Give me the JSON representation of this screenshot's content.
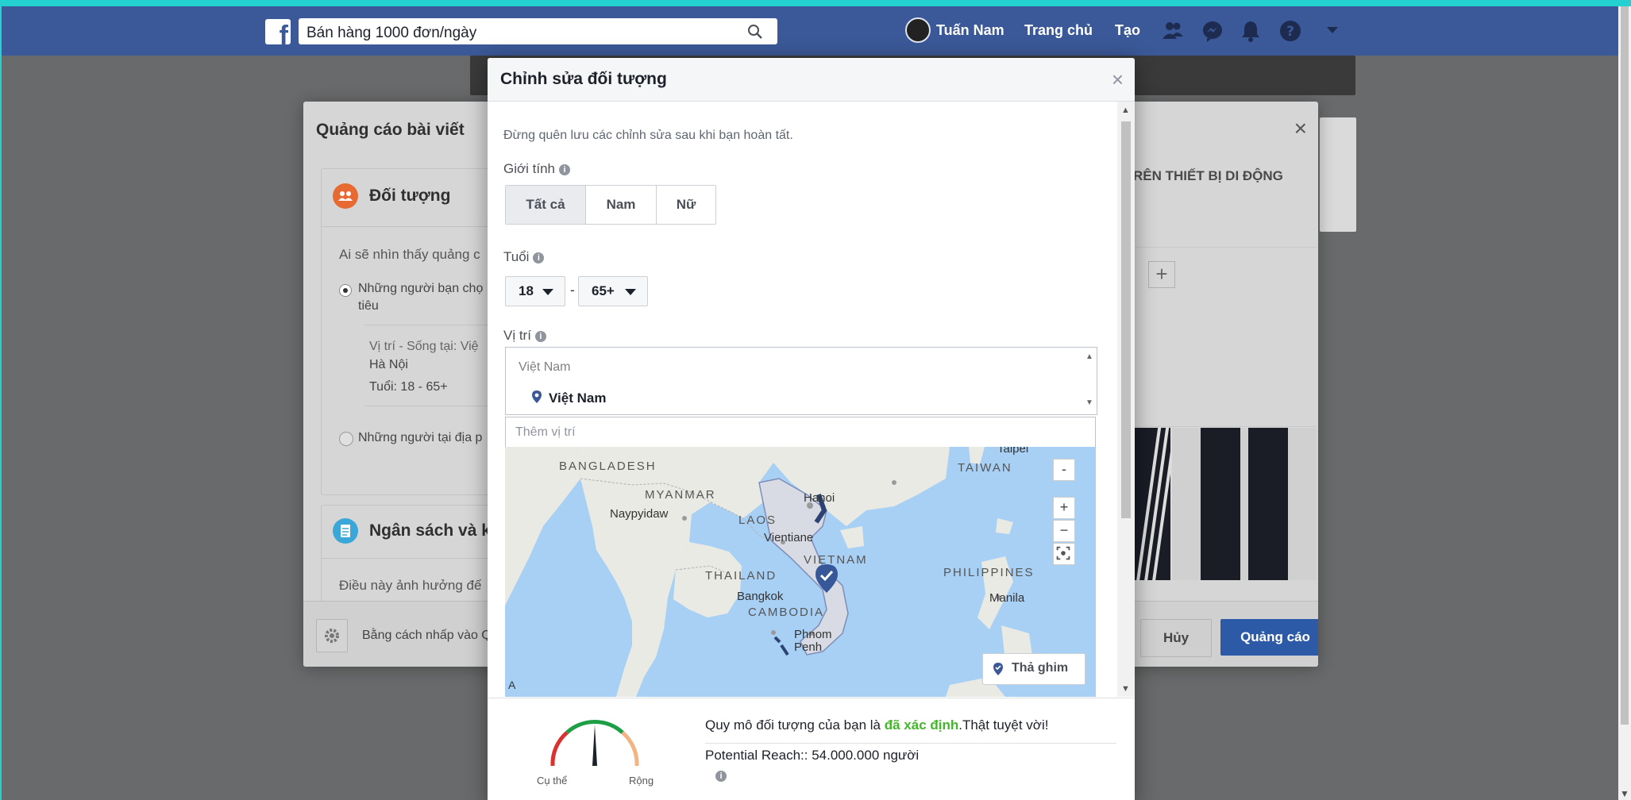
{
  "topbar": {
    "search_value": "Bán hàng 1000 đơn/ngày",
    "user_name": "Tuấn Nam",
    "nav_home": "Trang chủ",
    "nav_create": "Tạo"
  },
  "background_modal": {
    "title": "Quảng cáo bài viết",
    "audience_card": {
      "title": "Đối tượng",
      "question": "Ai sẽ nhìn thấy quảng c",
      "option1_line1": "Những người bạn chọ",
      "option1_line2": "tiêu",
      "detail_location": "Vị trí - Sống tại: Việ",
      "detail_city": "Hà Nội",
      "detail_age": "Tuổi: 18 - 65+",
      "option2": "Những người tại địa p"
    },
    "budget_card": {
      "title": "Ngân sách và kh",
      "text": "Điều này ảnh hưởng đế"
    },
    "right_tab": "RÊN THIẾT BỊ DI ĐỘNG",
    "footer_text": "Bằng cách nhấp vào Q",
    "cancel_label": "Hủy",
    "submit_label": "Quảng cáo"
  },
  "edit_audience": {
    "title": "Chỉnh sửa đối tượng",
    "close_label": "×",
    "hint": "Đừng quên lưu các chỉnh sửa sau khi bạn hoàn tất.",
    "gender": {
      "label": "Giới tính",
      "options": [
        "Tất cả",
        "Nam",
        "Nữ"
      ],
      "selected": "Tất cả"
    },
    "age": {
      "label": "Tuổi",
      "min": "18",
      "separator": "-",
      "max": "65+"
    },
    "location": {
      "label": "Vị trí",
      "group": "Việt Nam",
      "selected": "Việt Nam",
      "add_placeholder": "Thêm vị trí"
    },
    "map": {
      "countries": [
        "BANGLADESH",
        "MYANMAR",
        "LAOS",
        "THAILAND",
        "VIETNAM",
        "CAMBODIA",
        "PHILIPPINES",
        "TAIWAN"
      ],
      "cities": [
        "Hanoi",
        "Naypyidaw",
        "Vientiane",
        "Bangkok",
        "Phnom",
        "Penh",
        "Manila",
        "Taipei"
      ],
      "pin_button": "Thả ghim",
      "zoom_in": "+",
      "zoom_out": "−",
      "collapse": "-",
      "attribution": "A"
    },
    "audience_size": {
      "prefix": "Quy mô đối tượng của bạn là ",
      "status": "đã xác định",
      "suffix": ".Thật tuyệt vời!",
      "reach": "Potential Reach:: 54.000.000 người",
      "gauge_left": "Cụ thể",
      "gauge_right": "Rộng"
    }
  }
}
